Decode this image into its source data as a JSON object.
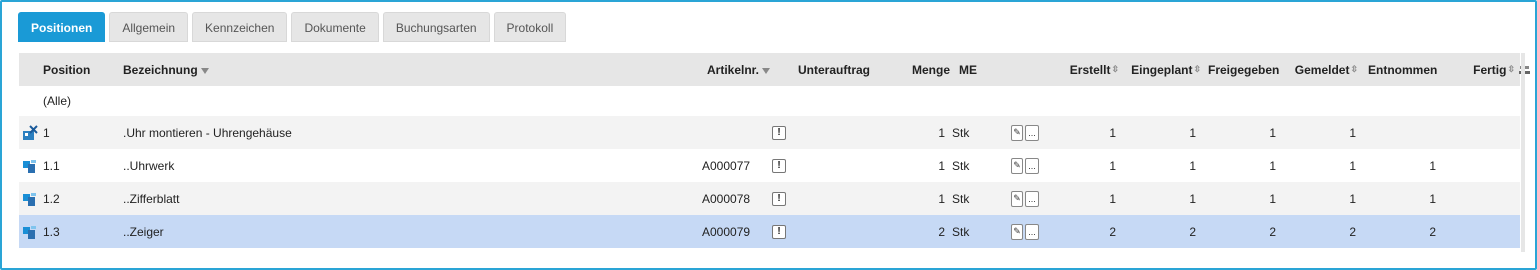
{
  "tabs": [
    {
      "label": "Positionen",
      "active": true
    },
    {
      "label": "Allgemein",
      "active": false
    },
    {
      "label": "Kennzeichen",
      "active": false
    },
    {
      "label": "Dokumente",
      "active": false
    },
    {
      "label": "Buchungsarten",
      "active": false
    },
    {
      "label": "Protokoll",
      "active": false
    }
  ],
  "columns": {
    "position": "Position",
    "bezeichnung": "Bezeichnung",
    "artikelnr": "Artikelnr.",
    "unterauftrag": "Unterauftrag",
    "menge": "Menge",
    "me": "ME",
    "erstellt": "Erstellt",
    "eingeplant": "Eingeplant",
    "freigegeben": "Freigegeben",
    "gemeldet": "Gemeldet",
    "entnommen": "Entnommen",
    "fertig": "Fertig"
  },
  "filter_row": {
    "position": "(Alle)"
  },
  "rows": [
    {
      "icon": "assembly-icon",
      "position": "1",
      "bezeichnung": ".Uhr montieren - Uhrengehäuse",
      "artikelnr": "",
      "menge": "1",
      "me": "Stk",
      "erstellt": "1",
      "eingeplant": "1",
      "freigegeben": "1",
      "gemeldet": "1",
      "entnommen": "",
      "fertig": ""
    },
    {
      "icon": "part-icon",
      "position": "1.1",
      "bezeichnung": "..Uhrwerk",
      "artikelnr": "A000077",
      "menge": "1",
      "me": "Stk",
      "erstellt": "1",
      "eingeplant": "1",
      "freigegeben": "1",
      "gemeldet": "1",
      "entnommen": "1",
      "fertig": ""
    },
    {
      "icon": "part-icon",
      "position": "1.2",
      "bezeichnung": "..Zifferblatt",
      "artikelnr": "A000078",
      "menge": "1",
      "me": "Stk",
      "erstellt": "1",
      "eingeplant": "1",
      "freigegeben": "1",
      "gemeldet": "1",
      "entnommen": "1",
      "fertig": ""
    },
    {
      "icon": "part-icon",
      "position": "1.3",
      "bezeichnung": "..Zeiger",
      "artikelnr": "A000079",
      "menge": "2",
      "me": "Stk",
      "erstellt": "2",
      "eingeplant": "2",
      "freigegeben": "2",
      "gemeldet": "2",
      "entnommen": "2",
      "fertig": ""
    }
  ],
  "labels": {
    "excl": "!",
    "ellipsis": "..."
  },
  "colors": {
    "accent": "#1a9ad6",
    "selected_row": "#c6d9f5",
    "header_bg": "#e6e6e6"
  }
}
